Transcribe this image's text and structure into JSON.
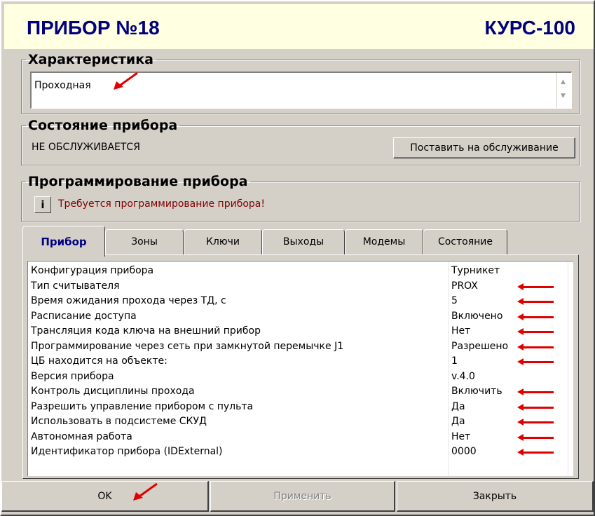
{
  "header": {
    "title": "ПРИБОР №18",
    "model": "КУРС-100"
  },
  "description": {
    "legend": "Характеристика",
    "value": "Проходная"
  },
  "status": {
    "legend": "Состояние прибора",
    "text": "НЕ ОБСЛУЖИВАЕТСЯ",
    "button": "Поставить на обслуживание"
  },
  "programming": {
    "legend": "Программирование прибора",
    "info_button": "i",
    "warning": "Требуется программирование прибора!",
    "warning_color": "#800000"
  },
  "tabs": [
    {
      "label": "Прибор",
      "active": true
    },
    {
      "label": "Зоны"
    },
    {
      "label": "Ключи"
    },
    {
      "label": "Выходы"
    },
    {
      "label": "Модемы"
    },
    {
      "label": "Состояние"
    }
  ],
  "properties": [
    {
      "label": "Конфигурация прибора",
      "value": "Турникет",
      "marked": false
    },
    {
      "label": "Тип считывателя",
      "value": "PROX",
      "marked": true
    },
    {
      "label": "Время ожидания прохода через ТД, с",
      "value": "5",
      "marked": true
    },
    {
      "label": "Расписание доступа",
      "value": "Включено",
      "marked": true
    },
    {
      "label": "Трансляция кода ключа на внешний прибор",
      "value": "Нет",
      "marked": true
    },
    {
      "label": "Программирование через сеть при замкнутой перемычке J1",
      "value": "Разрешено",
      "marked": true
    },
    {
      "label": "ЦБ находится на объекте:",
      "value": "1",
      "marked": true
    },
    {
      "label": "Версия прибора",
      "value": "v.4.0",
      "marked": false
    },
    {
      "label": "Контроль дисциплины прохода",
      "value": "Включить",
      "marked": true
    },
    {
      "label": "Разрешить управление прибором с пульта",
      "value": "Да",
      "marked": true
    },
    {
      "label": "Использовать в подсистеме СКУД",
      "value": "Да",
      "marked": true
    },
    {
      "label": "Автономная работа",
      "value": "Нет",
      "marked": true
    },
    {
      "label": "Идентификатор прибора (IDExternal)",
      "value": "0000",
      "marked": true
    }
  ],
  "buttons": {
    "ok": "OK",
    "apply": "Применить",
    "close": "Закрыть"
  },
  "colors": {
    "header_bg": "#ffffe1",
    "title": "#000080",
    "annotation_arrow": "#e00000"
  }
}
